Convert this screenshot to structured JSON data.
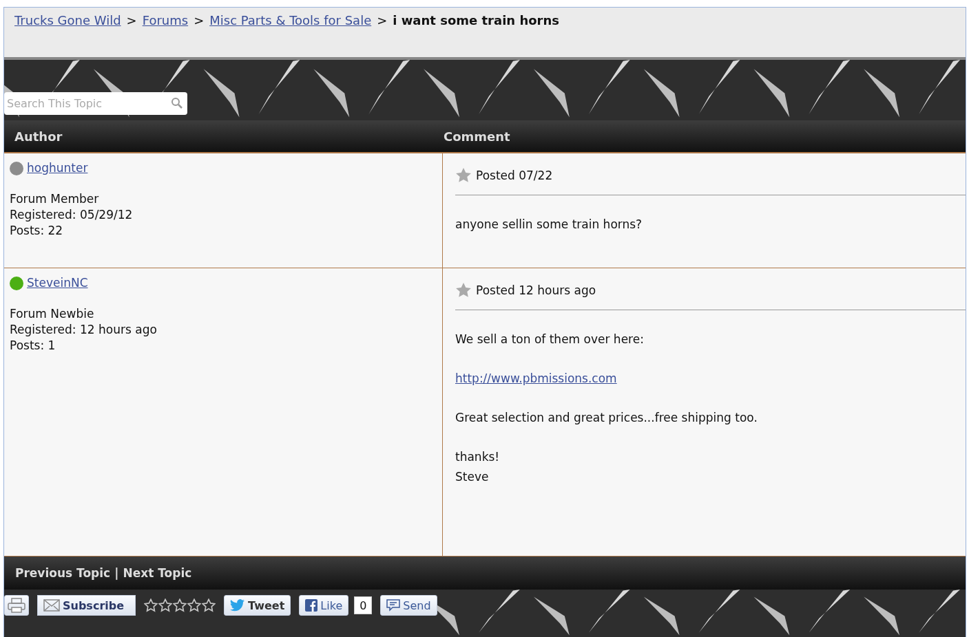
{
  "breadcrumb": {
    "links": [
      "Trucks Gone Wild",
      "Forums",
      "Misc Parts & Tools for Sale"
    ],
    "separator": ">",
    "current": "i want some train horns"
  },
  "search": {
    "placeholder": "Search This Topic"
  },
  "table": {
    "columns": [
      "Author",
      "Comment"
    ],
    "rows": [
      {
        "author": {
          "name": "hoghunter",
          "color": "#8c8c8c",
          "rank": "Forum Member",
          "registered": "Registered: 05/29/12",
          "posts": "Posts: 22"
        },
        "posted": "Posted 07/22",
        "paragraphs": [
          [
            {
              "kind": "text",
              "text": "anyone sellin some train horns?"
            }
          ]
        ]
      },
      {
        "author": {
          "name": "SteveinNC",
          "color": "#4caf14",
          "rank": "Forum Newbie",
          "registered": "Registered: 12 hours ago",
          "posts": "Posts: 1"
        },
        "posted": "Posted 12 hours ago",
        "paragraphs": [
          [
            {
              "kind": "text",
              "text": "We sell a ton of them over here:"
            }
          ],
          [
            {
              "kind": "link",
              "text": "http://www.pbmissions.com"
            }
          ],
          [
            {
              "kind": "text",
              "text": "Great selection and great prices...free shipping too."
            }
          ],
          [
            {
              "kind": "text",
              "text": "thanks!"
            },
            {
              "kind": "text",
              "text": "Steve"
            }
          ]
        ]
      }
    ]
  },
  "topic_nav": {
    "previous": "Previous Topic",
    "separator": "|",
    "next": "Next Topic"
  },
  "toolbar": {
    "subscribe": "Subscribe",
    "rating": {
      "stars": 0
    },
    "tweet": "Tweet",
    "like": "Like",
    "like_count": "0",
    "send": "Send"
  }
}
